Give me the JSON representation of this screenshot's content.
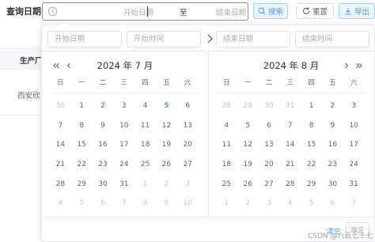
{
  "filter": {
    "label": "查询日期",
    "start_placeholder": "开始日期",
    "separator": "至",
    "end_placeholder": "结束日期"
  },
  "toolbar": {
    "search_label": "搜索",
    "reset_label": "重置",
    "export_label": "导出"
  },
  "table": {
    "manufacturer_header": "生产厂",
    "manufacturer_cell": "西安欣"
  },
  "picker": {
    "start_date_placeholder": "开始日期",
    "start_time_placeholder": "开始时间",
    "end_date_placeholder": "结束日期",
    "end_time_placeholder": "结束时间",
    "weekdays": [
      "日",
      "一",
      "二",
      "三",
      "四",
      "五",
      "六"
    ],
    "left": {
      "title": "2024 年 7 月",
      "weeks": [
        [
          {
            "d": "30",
            "off": true
          },
          {
            "d": "1"
          },
          {
            "d": "2"
          },
          {
            "d": "3"
          },
          {
            "d": "4"
          },
          {
            "d": "5",
            "today": true
          },
          {
            "d": "6"
          }
        ],
        [
          {
            "d": "7"
          },
          {
            "d": "8"
          },
          {
            "d": "9"
          },
          {
            "d": "10"
          },
          {
            "d": "11"
          },
          {
            "d": "12"
          },
          {
            "d": "13"
          }
        ],
        [
          {
            "d": "14"
          },
          {
            "d": "15"
          },
          {
            "d": "16"
          },
          {
            "d": "17"
          },
          {
            "d": "18"
          },
          {
            "d": "19"
          },
          {
            "d": "20"
          }
        ],
        [
          {
            "d": "21"
          },
          {
            "d": "22"
          },
          {
            "d": "23"
          },
          {
            "d": "24"
          },
          {
            "d": "25"
          },
          {
            "d": "26"
          },
          {
            "d": "27"
          }
        ],
        [
          {
            "d": "28"
          },
          {
            "d": "29"
          },
          {
            "d": "30"
          },
          {
            "d": "31"
          },
          {
            "d": "1",
            "off": true
          },
          {
            "d": "2",
            "off": true
          },
          {
            "d": "3",
            "off": true
          }
        ],
        [
          {
            "d": "4",
            "off": true
          },
          {
            "d": "5",
            "off": true
          },
          {
            "d": "6",
            "off": true
          },
          {
            "d": "7",
            "off": true
          },
          {
            "d": "8",
            "off": true
          },
          {
            "d": "9",
            "off": true
          },
          {
            "d": "10",
            "off": true
          }
        ]
      ]
    },
    "right": {
      "title": "2024 年 8 月",
      "weeks": [
        [
          {
            "d": "28",
            "off": true
          },
          {
            "d": "29",
            "off": true
          },
          {
            "d": "30",
            "off": true
          },
          {
            "d": "31",
            "off": true
          },
          {
            "d": "1"
          },
          {
            "d": "2"
          },
          {
            "d": "3"
          }
        ],
        [
          {
            "d": "4"
          },
          {
            "d": "5"
          },
          {
            "d": "6"
          },
          {
            "d": "7"
          },
          {
            "d": "8"
          },
          {
            "d": "9"
          },
          {
            "d": "10"
          }
        ],
        [
          {
            "d": "11"
          },
          {
            "d": "12"
          },
          {
            "d": "13"
          },
          {
            "d": "14"
          },
          {
            "d": "15"
          },
          {
            "d": "16"
          },
          {
            "d": "17"
          }
        ],
        [
          {
            "d": "18"
          },
          {
            "d": "19"
          },
          {
            "d": "20"
          },
          {
            "d": "21"
          },
          {
            "d": "22"
          },
          {
            "d": "23"
          },
          {
            "d": "24"
          }
        ],
        [
          {
            "d": "25"
          },
          {
            "d": "26"
          },
          {
            "d": "27"
          },
          {
            "d": "28"
          },
          {
            "d": "29"
          },
          {
            "d": "30"
          },
          {
            "d": "31"
          }
        ],
        [
          {
            "d": "1",
            "off": true
          },
          {
            "d": "2",
            "off": true
          },
          {
            "d": "3",
            "off": true
          },
          {
            "d": "4",
            "off": true
          },
          {
            "d": "5",
            "off": true
          },
          {
            "d": "6",
            "off": true
          },
          {
            "d": "7",
            "off": true
          }
        ]
      ]
    },
    "clear_label": "清空",
    "confirm_label": "确定"
  },
  "watermark": "CSDN @六百七十七",
  "colors": {
    "accent": "#409eff",
    "border": "#dcdfe6",
    "disabled_text": "#c0c4cc",
    "text": "#606266"
  },
  "icons": {
    "range_prefix": "clock-icon",
    "search": "search-icon",
    "reset": "refresh-icon",
    "export": "download-icon"
  }
}
